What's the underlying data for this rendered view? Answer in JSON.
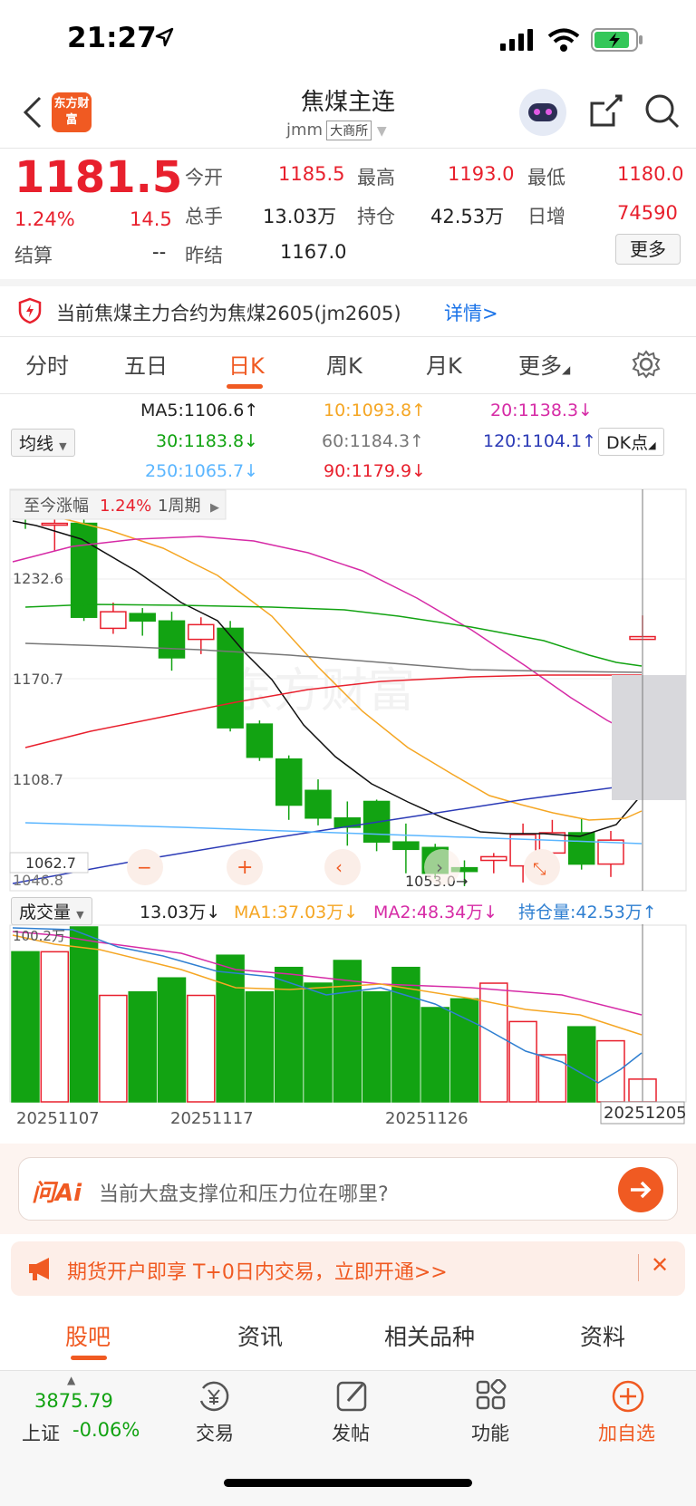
{
  "status": {
    "time": "21:27"
  },
  "header": {
    "logo_text": "东方财富",
    "title": "焦煤主连",
    "code": "jmm",
    "exchange": "大商所"
  },
  "quote": {
    "price": "1181.5",
    "change_pct": "1.24%",
    "change": "14.5",
    "open_label": "今开",
    "open": "1185.5",
    "high_label": "最高",
    "high": "1193.0",
    "low_label": "最低",
    "low": "1180.0",
    "volume_label": "总手",
    "volume": "13.03万",
    "oi_label": "持仓",
    "oi": "42.53万",
    "daily_inc_label": "日增",
    "daily_inc": "74590",
    "settle_label": "结算",
    "settle": "--",
    "prev_settle_label": "昨结",
    "prev_settle": "1167.0",
    "more_label": "更多"
  },
  "notice": {
    "text": "当前焦煤主力合约为焦煤2605(jm2605)",
    "link": "详情>"
  },
  "tabs": [
    "分时",
    "五日",
    "日K",
    "周K",
    "月K",
    "更多"
  ],
  "ma": {
    "selector": "均线",
    "ma5": "MA5:1106.6↑",
    "ma10": "10:1093.8↑",
    "ma20": "20:1138.3↓",
    "ma30": "30:1183.8↓",
    "ma60": "60:1184.3↑",
    "ma120": "120:1104.1↑",
    "ma250": "250:1065.7↓",
    "ma90": "90:1179.9↓",
    "dk": "DK点"
  },
  "chart": {
    "period_label": "至今涨幅",
    "period_pct": "1.24%",
    "period": "1周期",
    "watermark": "东方财富",
    "y_labels": [
      "1232.6",
      "1170.7",
      "1108.7",
      "1062.7",
      "1046.8"
    ],
    "low_marker": "1053.0→"
  },
  "volume": {
    "selector": "成交量",
    "vol": "13.03万↓",
    "ma1": "MA1:37.03万↓",
    "ma2": "MA2:48.34万↓",
    "oi": "持仓量:42.53万↑",
    "top_label": "100.2万",
    "dates": [
      "20251107",
      "20251117",
      "20251126",
      "20251205"
    ]
  },
  "chart_data": {
    "type": "candlestick",
    "title": "",
    "candles": [
      {
        "o": 1252,
        "c": 1250,
        "h": 1256,
        "l": 1240
      },
      {
        "o": 1243,
        "c": 1243,
        "h": 1250,
        "l": 1228
      },
      {
        "o": 1243,
        "c": 1192,
        "h": 1248,
        "l": 1190
      },
      {
        "o": 1186,
        "c": 1195,
        "h": 1200,
        "l": 1183
      },
      {
        "o": 1194,
        "c": 1190,
        "h": 1197,
        "l": 1182
      },
      {
        "o": 1190,
        "c": 1170,
        "h": 1195,
        "l": 1163
      },
      {
        "o": 1180,
        "c": 1188,
        "h": 1192,
        "l": 1172
      },
      {
        "o": 1186,
        "c": 1132,
        "h": 1190,
        "l": 1130
      },
      {
        "o": 1134,
        "c": 1116,
        "h": 1136,
        "l": 1114
      },
      {
        "o": 1115,
        "c": 1090,
        "h": 1117,
        "l": 1082
      },
      {
        "o": 1098,
        "c": 1083,
        "h": 1104,
        "l": 1079
      },
      {
        "o": 1083,
        "c": 1078,
        "h": 1092,
        "l": 1068
      },
      {
        "o": 1092,
        "c": 1070,
        "h": 1093,
        "l": 1065
      },
      {
        "o": 1070,
        "c": 1066,
        "h": 1080,
        "l": 1053
      },
      {
        "o": 1067,
        "c": 1053,
        "h": 1069,
        "l": 1050
      },
      {
        "o": 1056,
        "c": 1054,
        "h": 1060,
        "l": 1046
      },
      {
        "o": 1060,
        "c": 1062,
        "h": 1064,
        "l": 1053
      },
      {
        "o": 1057,
        "c": 1074,
        "h": 1080,
        "l": 1048
      },
      {
        "o": 1064,
        "c": 1075,
        "h": 1082,
        "l": 1052
      },
      {
        "o": 1075,
        "c": 1058,
        "h": 1083,
        "l": 1055
      },
      {
        "o": 1058,
        "c": 1071,
        "h": 1076,
        "l": 1051
      },
      {
        "o": 1180,
        "c": 1181.5,
        "h": 1193,
        "l": 1180
      }
    ],
    "volumes_wan": [
      86,
      86,
      100.2,
      61,
      63,
      71,
      61,
      84,
      63,
      77,
      68,
      81,
      63,
      77,
      54,
      59,
      68,
      46,
      27,
      43,
      35,
      13.03
    ]
  },
  "ai": {
    "brand": "问Ai",
    "placeholder": "当前大盘支撑位和压力位在哪里?"
  },
  "promo": {
    "text": "期货开户即享 T+0日内交易，立即开通>>"
  },
  "bottom_tabs": [
    "股吧",
    "资讯",
    "相关品种",
    "资料"
  ],
  "footer": {
    "index_value": "3875.79",
    "index_name": "上证",
    "index_change": "-0.06%",
    "trade": "交易",
    "post": "发帖",
    "func": "功能",
    "add": "加自选"
  },
  "colors": {
    "up": "#e8202d",
    "down": "#12a312",
    "accent": "#f05a22"
  }
}
